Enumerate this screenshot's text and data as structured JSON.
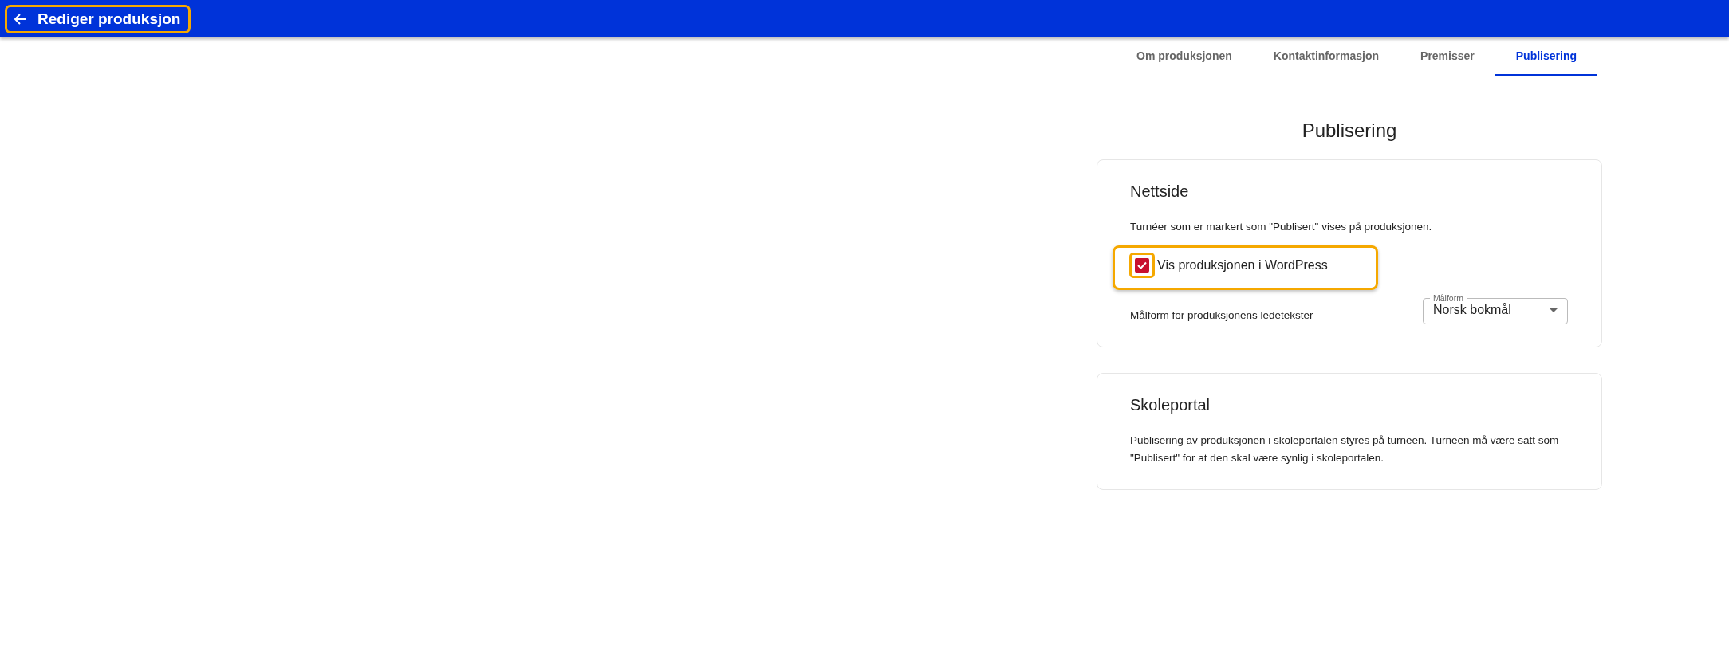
{
  "header": {
    "title": "Rediger produksjon",
    "highlighted": true
  },
  "tabs": [
    {
      "label": "Om produksjonen",
      "selected": false
    },
    {
      "label": "Kontaktinformasjon",
      "selected": false
    },
    {
      "label": "Premisser",
      "selected": false
    },
    {
      "label": "Publisering",
      "selected": true
    }
  ],
  "page_title": "Publisering",
  "website_card": {
    "title": "Nettside",
    "description": "Turnéer som er markert som \"Publisert\" vises på produksjonen.",
    "checkbox": {
      "label": "Vis produksjonen i WordPress",
      "checked": true,
      "highlighted": true,
      "box_highlighted": true
    },
    "language_label": "Målform for produksjonens ledetekster",
    "select": {
      "label": "Målform",
      "value": "Norsk bokmål"
    }
  },
  "school_card": {
    "title": "Skoleportal",
    "description": "Publisering av produksjonen i skoleportalen styres på turneen. Turneen må være satt som \"Publisert\" for at den skal være synlig i skoleportalen."
  }
}
